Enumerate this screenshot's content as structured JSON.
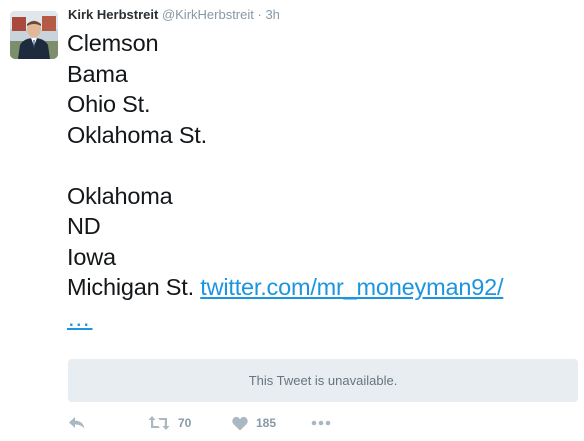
{
  "tweet": {
    "author_name": "Kirk Herbstreit",
    "handle": "@KirkHerbstreit",
    "separator": " · ",
    "timestamp": "3h",
    "lines": [
      "Clemson",
      "Bama",
      "Ohio St.",
      "Oklahoma St.",
      "",
      "Oklahoma",
      "ND",
      "Iowa",
      "Michigan St. "
    ],
    "link_text": "twitter.com/mr_moneyman92/",
    "link_continuation": "…",
    "quoted_unavailable_text": "This Tweet is unavailable."
  },
  "actions": {
    "reply_icon": "reply-icon",
    "retweet_icon": "retweet-icon",
    "retweet_count": "70",
    "like_icon": "heart-icon",
    "like_count": "185",
    "more_icon": "more-dots-icon"
  },
  "colors": {
    "text": "#14171a",
    "muted": "#8899a6",
    "link": "#1b95e0",
    "card_bg": "#e8edf1"
  }
}
